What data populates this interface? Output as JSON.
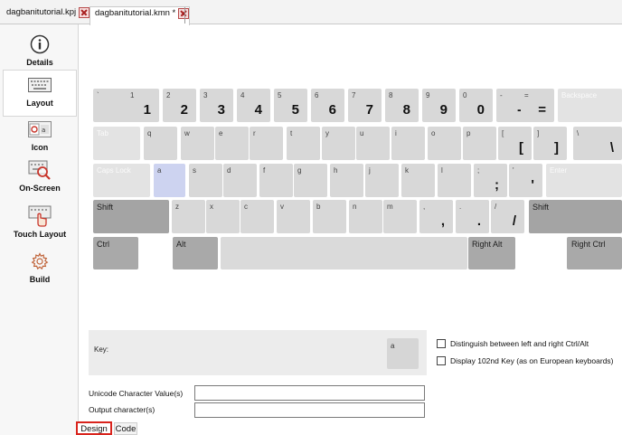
{
  "file_tabs": [
    {
      "label": "dagbanitutorial.kpj"
    },
    {
      "label": "dagbanitutorial.kmn *"
    }
  ],
  "sidebar": {
    "items": [
      {
        "label": "Details",
        "icon": "info-icon"
      },
      {
        "label": "Layout",
        "icon": "keyboard-icon"
      },
      {
        "label": "Icon",
        "icon": "icon-editor-icon"
      },
      {
        "label": "On-Screen",
        "icon": "on-screen-keyboard-icon"
      },
      {
        "label": "Touch Layout",
        "icon": "touch-layout-icon"
      },
      {
        "label": "Build",
        "icon": "gear-icon"
      }
    ],
    "selected": "Layout"
  },
  "keyboard": {
    "rows": [
      {
        "keys": [
          {
            "name": "key-backtick",
            "tl": "`",
            "bc": "`"
          },
          {
            "name": "key-1",
            "tl": "1",
            "bc": "1"
          },
          {
            "name": "key-2",
            "tl": "2",
            "bc": "2"
          },
          {
            "name": "key-3",
            "tl": "3",
            "bc": "3"
          },
          {
            "name": "key-4",
            "tl": "4",
            "bc": "4"
          },
          {
            "name": "key-5",
            "tl": "5",
            "bc": "5"
          },
          {
            "name": "key-6",
            "tl": "6",
            "bc": "6"
          },
          {
            "name": "key-7",
            "tl": "7",
            "bc": "7"
          },
          {
            "name": "key-8",
            "tl": "8",
            "bc": "8"
          },
          {
            "name": "key-9",
            "tl": "9",
            "bc": "9"
          },
          {
            "name": "key-0",
            "tl": "0",
            "bc": "0"
          },
          {
            "name": "key-minus",
            "tl": "-",
            "bc": "-"
          },
          {
            "name": "key-equals",
            "tl": "=",
            "bc": "="
          },
          {
            "name": "key-backspace",
            "tl": "Backspace",
            "bc": ""
          }
        ]
      },
      {
        "keys": [
          {
            "name": "key-tab",
            "tl": "Tab",
            "bc": ""
          },
          {
            "name": "key-q",
            "tl": "q",
            "bc": ""
          },
          {
            "name": "key-w",
            "tl": "w",
            "bc": ""
          },
          {
            "name": "key-e",
            "tl": "e",
            "bc": ""
          },
          {
            "name": "key-r",
            "tl": "r",
            "bc": ""
          },
          {
            "name": "key-t",
            "tl": "t",
            "bc": ""
          },
          {
            "name": "key-y",
            "tl": "y",
            "bc": ""
          },
          {
            "name": "key-u",
            "tl": "u",
            "bc": ""
          },
          {
            "name": "key-i",
            "tl": "i",
            "bc": ""
          },
          {
            "name": "key-o",
            "tl": "o",
            "bc": ""
          },
          {
            "name": "key-p",
            "tl": "p",
            "bc": ""
          },
          {
            "name": "key-lbracket",
            "tl": "[",
            "bc": "["
          },
          {
            "name": "key-rbracket",
            "tl": "]",
            "bc": "]"
          },
          {
            "name": "key-backslash",
            "tl": "\\",
            "bc": "\\"
          }
        ]
      },
      {
        "keys": [
          {
            "name": "key-capslock",
            "tl": "Caps Lock",
            "bc": ""
          },
          {
            "name": "key-a",
            "tl": "a",
            "bc": ""
          },
          {
            "name": "key-s",
            "tl": "s",
            "bc": ""
          },
          {
            "name": "key-d",
            "tl": "d",
            "bc": ""
          },
          {
            "name": "key-f",
            "tl": "f",
            "bc": ""
          },
          {
            "name": "key-g",
            "tl": "g",
            "bc": ""
          },
          {
            "name": "key-h",
            "tl": "h",
            "bc": ""
          },
          {
            "name": "key-j",
            "tl": "j",
            "bc": ""
          },
          {
            "name": "key-k",
            "tl": "k",
            "bc": ""
          },
          {
            "name": "key-l",
            "tl": "l",
            "bc": ""
          },
          {
            "name": "key-semicolon",
            "tl": ";",
            "bc": ";"
          },
          {
            "name": "key-quote",
            "tl": "'",
            "bc": "'"
          },
          {
            "name": "key-enter",
            "tl": "Enter",
            "bc": ""
          }
        ]
      },
      {
        "keys": [
          {
            "name": "key-shift-left",
            "tl": "Shift",
            "bc": ""
          },
          {
            "name": "key-z",
            "tl": "z",
            "bc": ""
          },
          {
            "name": "key-x",
            "tl": "x",
            "bc": ""
          },
          {
            "name": "key-c",
            "tl": "c",
            "bc": ""
          },
          {
            "name": "key-v",
            "tl": "v",
            "bc": ""
          },
          {
            "name": "key-b",
            "tl": "b",
            "bc": ""
          },
          {
            "name": "key-n",
            "tl": "n",
            "bc": ""
          },
          {
            "name": "key-m",
            "tl": "m",
            "bc": ""
          },
          {
            "name": "key-comma",
            "tl": ",",
            "bc": ","
          },
          {
            "name": "key-period",
            "tl": ".",
            "bc": "."
          },
          {
            "name": "key-slash",
            "tl": "/",
            "bc": "/"
          },
          {
            "name": "key-shift-right",
            "tl": "Shift",
            "bc": ""
          }
        ]
      },
      {
        "keys": [
          {
            "name": "key-ctrl-left",
            "tl": "Ctrl",
            "bc": ""
          },
          {
            "name": "key-alt-left",
            "tl": "Alt",
            "bc": ""
          },
          {
            "name": "key-space",
            "tl": "",
            "bc": ""
          },
          {
            "name": "key-right-alt",
            "tl": "Right Alt",
            "bc": ""
          },
          {
            "name": "key-right-ctrl",
            "tl": "Right Ctrl",
            "bc": ""
          }
        ]
      }
    ],
    "selected_key": "a"
  },
  "key_panel": {
    "label": "Key:",
    "key_preview": "a"
  },
  "options": {
    "distinguish_label": "Distinguish between left and right Ctrl/Alt",
    "display102_label": "Display 102nd Key (as on European keyboards)",
    "distinguish_checked": false,
    "display102_checked": false
  },
  "fields": {
    "unicode_label": "Unicode Character Value(s)",
    "unicode_value": "",
    "output_label": "Output character(s)",
    "output_value": ""
  },
  "bottom_tabs": {
    "design": "Design",
    "code": "Code",
    "active": "Design"
  },
  "colors": {
    "selected_key": "#cdd3f0",
    "modifier_key": "#a9a9a9",
    "normal_key": "#d8d8d8",
    "active_tab_outline": "#d9241d"
  }
}
